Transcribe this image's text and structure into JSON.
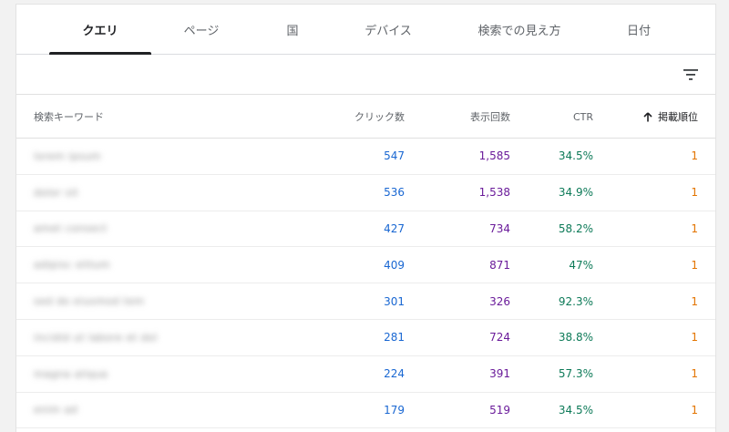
{
  "tabs": [
    {
      "label": "クエリ",
      "active": true
    },
    {
      "label": "ページ",
      "active": false
    },
    {
      "label": "国",
      "active": false
    },
    {
      "label": "デバイス",
      "active": false
    },
    {
      "label": "検索での見え方",
      "active": false
    },
    {
      "label": "日付",
      "active": false
    }
  ],
  "toolbar": {
    "filter_icon": "filter-list-icon"
  },
  "table": {
    "headers": {
      "keyword": "検索キーワード",
      "clicks": "クリック数",
      "impressions": "表示回数",
      "ctr": "CTR",
      "position": "掲載順位"
    },
    "sort": {
      "column": "position",
      "direction": "ascending",
      "icon": "arrow-upward-icon"
    },
    "rows": [
      {
        "keyword": "lorem ipsum",
        "clicks": "547",
        "impressions": "1,585",
        "ctr": "34.5%",
        "position": "1"
      },
      {
        "keyword": "dolor sit",
        "clicks": "536",
        "impressions": "1,538",
        "ctr": "34.9%",
        "position": "1"
      },
      {
        "keyword": "amet consect",
        "clicks": "427",
        "impressions": "734",
        "ctr": "58.2%",
        "position": "1"
      },
      {
        "keyword": "adipisc elitum",
        "clicks": "409",
        "impressions": "871",
        "ctr": "47%",
        "position": "1"
      },
      {
        "keyword": "sed do eiusmod tem",
        "clicks": "301",
        "impressions": "326",
        "ctr": "92.3%",
        "position": "1"
      },
      {
        "keyword": "incidid ut labore et dol",
        "clicks": "281",
        "impressions": "724",
        "ctr": "38.8%",
        "position": "1"
      },
      {
        "keyword": "magna aliqua",
        "clicks": "224",
        "impressions": "391",
        "ctr": "57.3%",
        "position": "1"
      },
      {
        "keyword": "enim ad",
        "clicks": "179",
        "impressions": "519",
        "ctr": "34.5%",
        "position": "1"
      }
    ]
  },
  "colors": {
    "clicks": "#1967d2",
    "impressions": "#6a1b9a",
    "ctr": "#0d7a58",
    "position": "#e37400"
  }
}
